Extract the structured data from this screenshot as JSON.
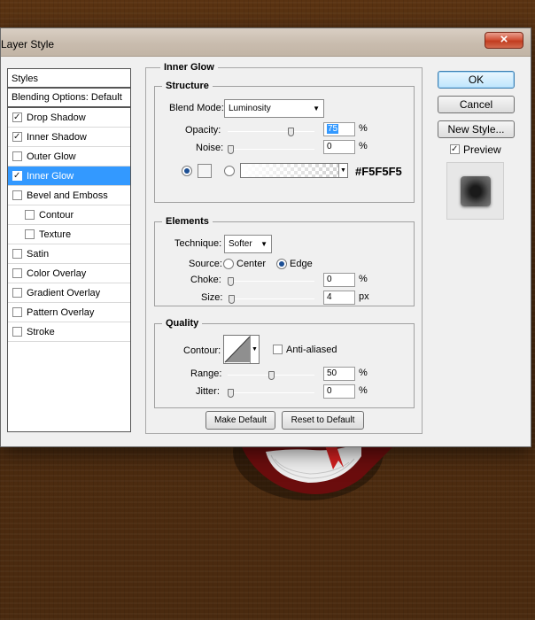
{
  "window": {
    "title": "Layer Style",
    "close_glyph": "×"
  },
  "styles_panel": {
    "header": "Styles",
    "blending_options": "Blending Options: Default",
    "items": [
      {
        "label": "Drop Shadow",
        "checked": true,
        "indent": false,
        "selected": false
      },
      {
        "label": "Inner Shadow",
        "checked": true,
        "indent": false,
        "selected": false
      },
      {
        "label": "Outer Glow",
        "checked": false,
        "indent": false,
        "selected": false
      },
      {
        "label": "Inner Glow",
        "checked": true,
        "indent": false,
        "selected": true
      },
      {
        "label": "Bevel and Emboss",
        "checked": false,
        "indent": false,
        "selected": false
      },
      {
        "label": "Contour",
        "checked": false,
        "indent": true,
        "selected": false
      },
      {
        "label": "Texture",
        "checked": false,
        "indent": true,
        "selected": false
      },
      {
        "label": "Satin",
        "checked": false,
        "indent": false,
        "selected": false
      },
      {
        "label": "Color Overlay",
        "checked": false,
        "indent": false,
        "selected": false
      },
      {
        "label": "Gradient Overlay",
        "checked": false,
        "indent": false,
        "selected": false
      },
      {
        "label": "Pattern Overlay",
        "checked": false,
        "indent": false,
        "selected": false
      },
      {
        "label": "Stroke",
        "checked": false,
        "indent": false,
        "selected": false
      }
    ]
  },
  "inner_glow": {
    "title": "Inner Glow",
    "structure": {
      "title": "Structure",
      "blend_mode_label": "Blend Mode:",
      "blend_mode_value": "Luminosity",
      "opacity_label": "Opacity:",
      "opacity_value": "75",
      "opacity_level": 0.75,
      "noise_label": "Noise:",
      "noise_value": "0",
      "noise_level": 0,
      "percent": "%",
      "color_hex": "#F5F5F5",
      "color_swatch": "#f5f5f5"
    },
    "elements": {
      "title": "Elements",
      "technique_label": "Technique:",
      "technique_value": "Softer",
      "source_label": "Source:",
      "source_center": "Center",
      "source_edge": "Edge",
      "choke_label": "Choke:",
      "choke_value": "0",
      "choke_level": 0,
      "size_label": "Size:",
      "size_value": "4",
      "size_level": 0.016,
      "percent": "%",
      "px": "px"
    },
    "quality": {
      "title": "Quality",
      "contour_label": "Contour:",
      "anti_aliased_label": "Anti-aliased",
      "range_label": "Range:",
      "range_value": "50",
      "range_level": 0.5,
      "jitter_label": "Jitter:",
      "jitter_value": "0",
      "jitter_level": 0,
      "percent": "%"
    },
    "make_default": "Make Default",
    "reset_default": "Reset to Default"
  },
  "actions": {
    "ok": "OK",
    "cancel": "Cancel",
    "new_style": "New Style...",
    "preview_label": "Preview",
    "preview_checked": true
  },
  "colors": {
    "selection": "#3399ff",
    "close_button": "#c23c1f",
    "background_wood": "#4e2c10"
  }
}
